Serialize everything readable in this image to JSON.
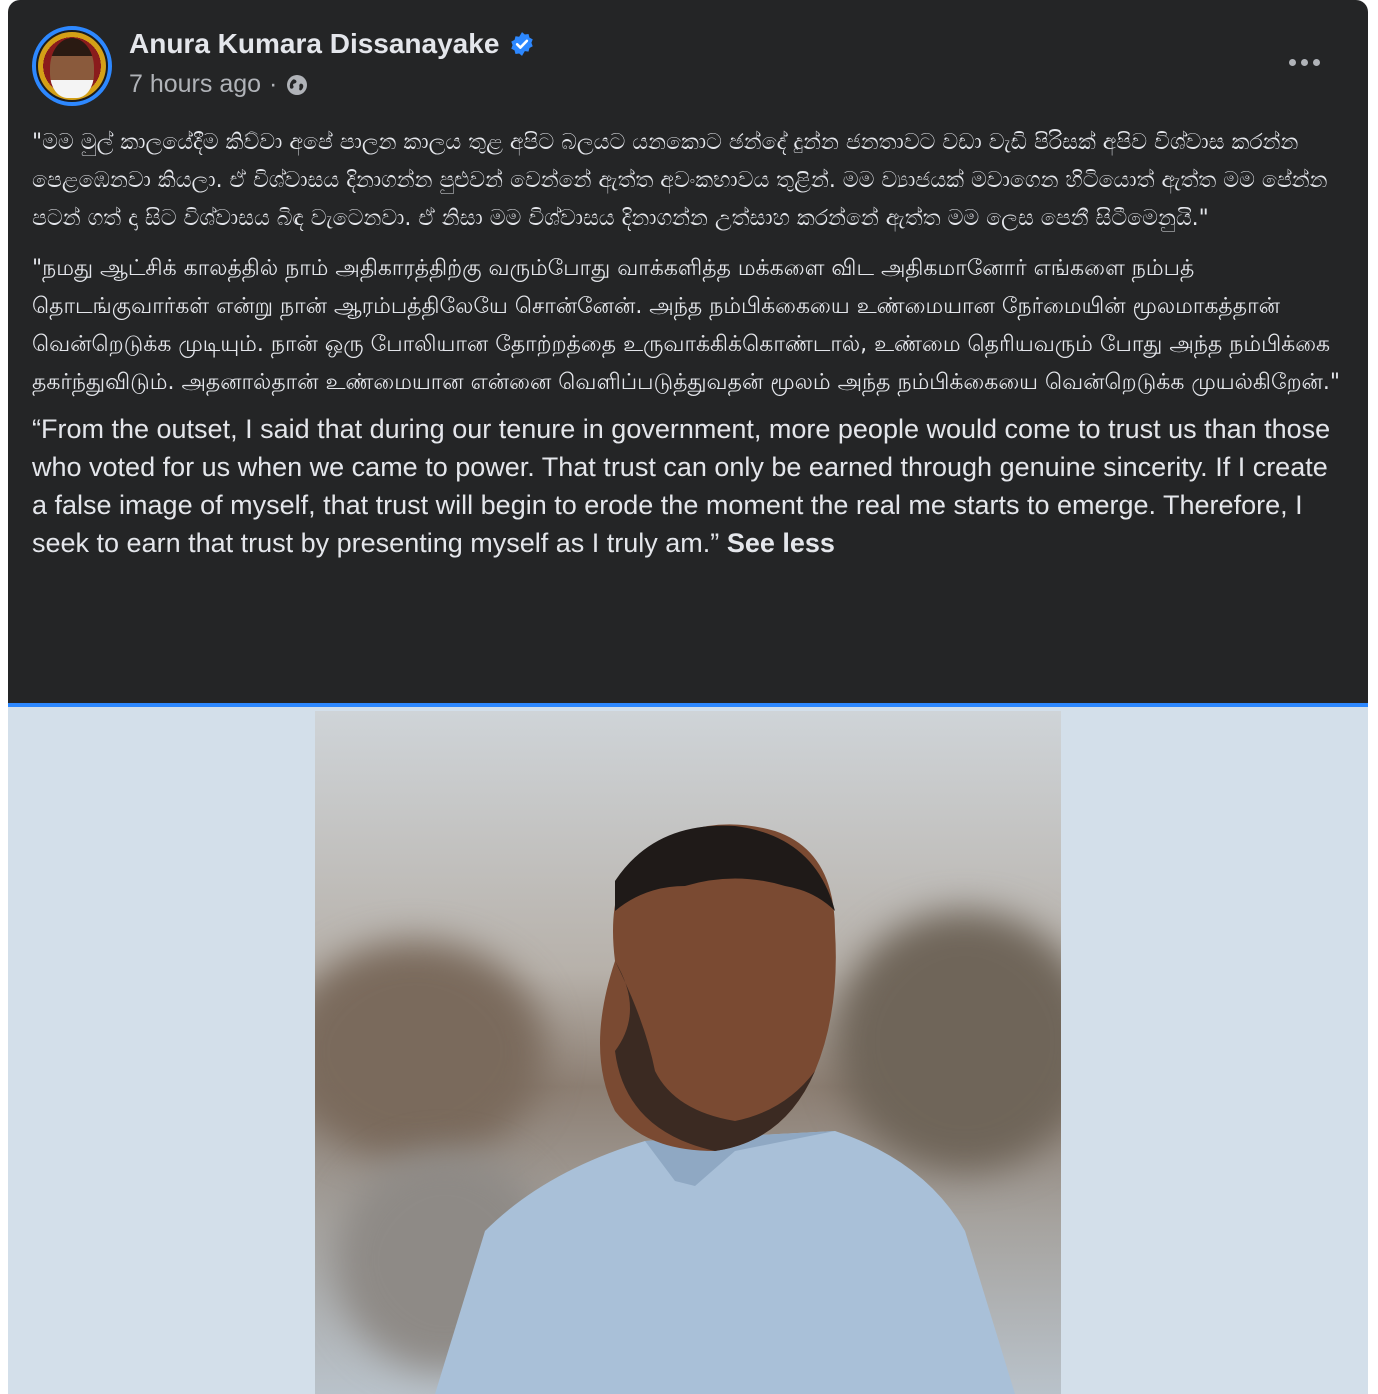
{
  "post": {
    "author": "Anura Kumara Dissanayake",
    "timestamp": "7 hours ago",
    "separator": "·",
    "verified_icon": "verified-badge-icon",
    "privacy_icon": "globe-icon",
    "more_icon": "more-options-icon",
    "text_sinhala": "\"මම මුල් කාලයේදීම කිව්වා අපේ පාලන කාලය තුළ අපිට බලයට යනකොට ඡන්දේ දුන්න ජනතාවට වඩා වැඩි පිරිසක් අපිව විශ්වාස කරන්න පෙළඹෙනවා කියලා. ඒ විශ්වාසය දිනාගන්න පුළුවන් වෙන්නේ ඇත්ත අවංකභාවය තුළින්. මම ව්‍යාජයක් මවාගෙන හිටියොත් ඇත්ත මම පේන්න පටන් ගත් දා සිට විශ්වාසය බිඳ වැටෙනවා. ඒ නිසා මම විශ්වාසය දිනාගන්න උත්සාහ කරන්නේ ඇත්ත මම ලෙස පෙනී සිටීමෙනුයි.\"",
    "text_tamil": "\"நமது ஆட்சிக் காலத்தில் நாம் அதிகாரத்திற்கு வரும்போது வாக்களித்த மக்களை விட அதிகமானோர் எங்களை நம்பத் தொடங்குவார்கள் என்று நான் ஆரம்பத்திலேயே சொன்னேன். அந்த நம்பிக்கையை உண்மையான நேர்மையின் மூலமாகத்தான் வென்றெடுக்க முடியும். நான் ஒரு போலியான தோற்றத்தை உருவாக்கிக்கொண்டால், உண்மை தெரியவரும் போது அந்த நம்பிக்கை தகர்ந்துவிடும். அதனால்தான் உண்மையான என்னை வெளிப்படுத்துவதன் மூலம் அந்த நம்பிக்கையை வென்றெடுக்க முயல்கிறேன்.\"",
    "text_english": "“From the outset, I said that during our tenure in government, more people would come to trust us than those who voted for us when we came to power. That trust can only be earned through genuine sincerity. If I create a false image of myself, that trust will begin to erode the moment the real me starts to emerge. Therefore, I seek to earn that trust by presenting myself as I truly am.”",
    "see_less": "See less"
  },
  "colors": {
    "card_bg": "#242526",
    "text_primary": "#e4e6eb",
    "text_secondary": "#b0b3b8",
    "accent": "#2d88ff",
    "photo_bg": "#d3dfea"
  }
}
